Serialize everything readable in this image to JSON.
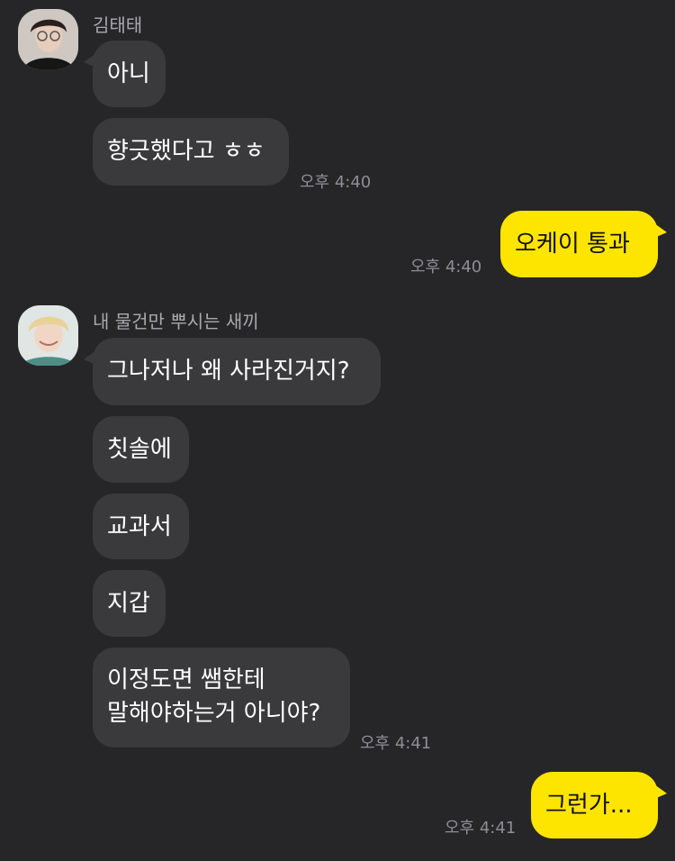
{
  "colors": {
    "background": "#262628",
    "incoming_bubble": "#3a3a3d",
    "outgoing_bubble": "#fee500",
    "sender_name": "#a9a9ad",
    "timestamp": "#8e8e93"
  },
  "chat": {
    "group1": {
      "sender": "김태태",
      "avatar_icon": "profile-photo-icon",
      "messages": [
        "아니",
        "향긋했다고 ㅎㅎ"
      ],
      "time": "오후 4:40"
    },
    "mine1": {
      "messages": [
        "오케이 통과"
      ],
      "time": "오후 4:40"
    },
    "group2": {
      "sender": "내 물건만 뿌시는 새끼",
      "avatar_icon": "profile-photo-icon",
      "messages": [
        "그나저나 왜 사라진거지?",
        "칫솔에",
        "교과서",
        "지갑"
      ],
      "last_message_line1": "이정도면 쌤한테",
      "last_message_line2": "말해야하는거 아니야?",
      "time": "오후 4:41"
    },
    "mine2": {
      "messages": [
        "그런가..."
      ],
      "time": "오후 4:41"
    }
  }
}
